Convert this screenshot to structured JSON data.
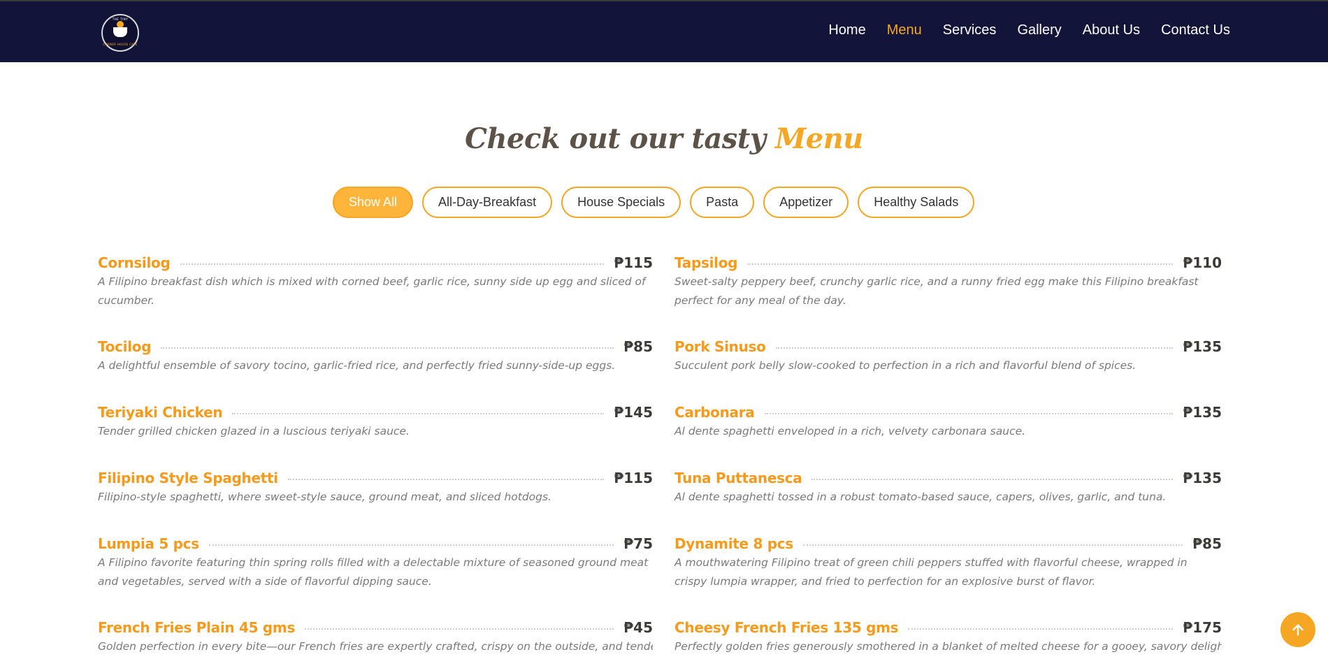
{
  "brand": {
    "logo_top": "THE TINY",
    "logo_bottom": "CORNER HOUSE CAFE"
  },
  "nav": {
    "items": [
      {
        "label": "Home",
        "active": false
      },
      {
        "label": "Menu",
        "active": true
      },
      {
        "label": "Services",
        "active": false
      },
      {
        "label": "Gallery",
        "active": false
      },
      {
        "label": "About Us",
        "active": false
      },
      {
        "label": "Contact Us",
        "active": false
      }
    ]
  },
  "section": {
    "title_main": "Check out our tasty ",
    "title_accent": "Menu"
  },
  "filters": [
    {
      "label": "Show All",
      "active": true
    },
    {
      "label": "All-Day-Breakfast",
      "active": false
    },
    {
      "label": "House Specials",
      "active": false
    },
    {
      "label": "Pasta",
      "active": false
    },
    {
      "label": "Appetizer",
      "active": false
    },
    {
      "label": "Healthy Salads",
      "active": false
    }
  ],
  "menu_left": [
    {
      "name": "Cornsilog",
      "price": "₱115",
      "desc": "A Filipino breakfast dish which is mixed with corned beef, garlic rice, sunny side up egg and sliced of cucumber."
    },
    {
      "name": "Tocilog",
      "price": "₱85",
      "desc": "A delightful ensemble of savory tocino, garlic-fried rice, and perfectly fried sunny-side-up eggs."
    },
    {
      "name": "Teriyaki Chicken",
      "price": "₱145",
      "desc": "Tender grilled chicken glazed in a luscious teriyaki sauce."
    },
    {
      "name": "Filipino Style Spaghetti",
      "price": "₱115",
      "desc": "Filipino-style spaghetti, where sweet-style sauce, ground meat, and sliced hotdogs."
    },
    {
      "name": "Lumpia 5 pcs",
      "price": "₱75",
      "desc": "A Filipino favorite featuring thin spring rolls filled with a delectable mixture of seasoned ground meat and vegetables, served with a side of flavorful dipping sauce."
    },
    {
      "name": "French Fries Plain 45 gms",
      "price": "₱45",
      "desc": "Golden perfection in every bite—our French fries are expertly crafted, crispy on the outside, and tender"
    }
  ],
  "menu_right": [
    {
      "name": "Tapsilog",
      "price": "₱110",
      "desc": "Sweet-salty peppery beef, crunchy garlic rice, and a runny fried egg make this Filipino breakfast perfect for any meal of the day."
    },
    {
      "name": "Pork Sinuso",
      "price": "₱135",
      "desc": "Succulent pork belly slow-cooked to perfection in a rich and flavorful blend of spices."
    },
    {
      "name": "Carbonara",
      "price": "₱135",
      "desc": "Al dente spaghetti enveloped in a rich, velvety carbonara sauce."
    },
    {
      "name": "Tuna Puttanesca",
      "price": "₱135",
      "desc": "Al dente spaghetti tossed in a robust tomato-based sauce, capers, olives, garlic, and tuna."
    },
    {
      "name": "Dynamite 8 pcs",
      "price": "₱85",
      "desc": "A mouthwatering Filipino treat of green chili peppers stuffed with flavorful cheese, wrapped in crispy lumpia wrapper, and fried to perfection for an explosive burst of flavor."
    },
    {
      "name": "Cheesy French Fries 135 gms",
      "price": "₱175",
      "desc": "Perfectly golden fries generously smothered in a blanket of melted cheese for a gooey, savory delight."
    }
  ],
  "colors": {
    "header_bg": "#13143a",
    "accent": "#f5a623",
    "item_name": "#f59a1b"
  },
  "icons": {
    "back_to_top": "arrow-up-icon"
  }
}
